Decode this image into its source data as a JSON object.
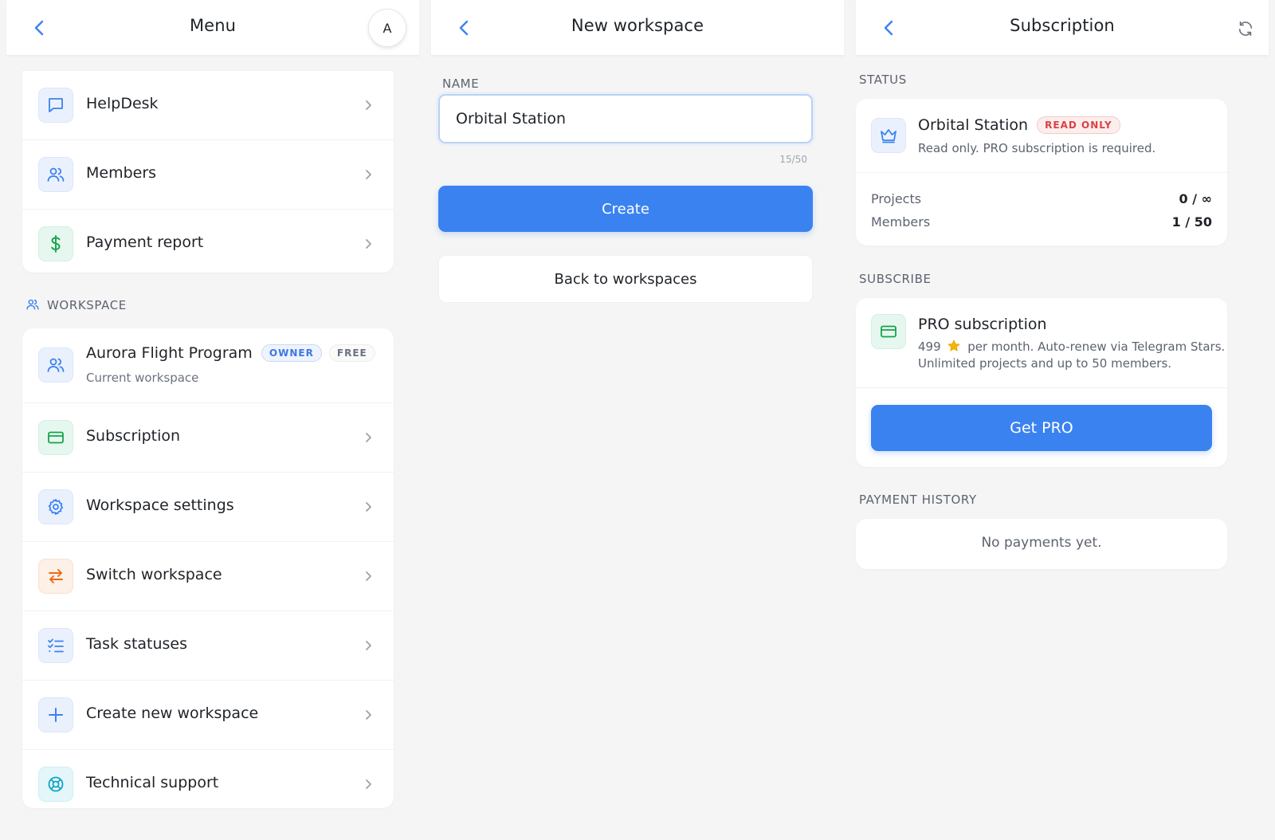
{
  "menu": {
    "title": "Menu",
    "avatar_letter": "A",
    "top_items": [
      {
        "label": "HelpDesk",
        "icon": "chat-bubble-icon"
      },
      {
        "label": "Members",
        "icon": "users-icon"
      },
      {
        "label": "Payment report",
        "icon": "dollar-icon"
      }
    ],
    "workspace_section_label": "WORKSPACE",
    "current_workspace": {
      "name": "Aurora Flight Program",
      "owner_badge": "OWNER",
      "plan_badge": "FREE",
      "subtitle": "Current workspace"
    },
    "workspace_items": [
      {
        "label": "Subscription",
        "icon": "credit-card-icon"
      },
      {
        "label": "Workspace settings",
        "icon": "gear-icon"
      },
      {
        "label": "Switch workspace",
        "icon": "swap-arrows-icon"
      },
      {
        "label": "Task statuses",
        "icon": "checklist-icon"
      },
      {
        "label": "Create new workspace",
        "icon": "plus-icon"
      },
      {
        "label": "Technical support",
        "icon": "lifebuoy-icon"
      }
    ]
  },
  "new_workspace": {
    "title": "New workspace",
    "name_label": "NAME",
    "name_value": "Orbital Station",
    "char_counter": "15/50",
    "create_label": "Create",
    "back_label": "Back to workspaces"
  },
  "subscription": {
    "title": "Subscription",
    "status_label": "STATUS",
    "status": {
      "workspace_name": "Orbital Station",
      "badge": "READ ONLY",
      "description": "Read only. PRO subscription is required.",
      "projects_label": "Projects",
      "projects_value": "0 / ∞",
      "members_label": "Members",
      "members_value": "1 / 50"
    },
    "subscribe_label": "SUBSCRIBE",
    "plan": {
      "name": "PRO subscription",
      "price": "499",
      "price_suffix": "per month. Auto-renew via Telegram Stars.",
      "details": "Unlimited projects and up to 50 members.",
      "button_label": "Get PRO"
    },
    "payment_history_label": "PAYMENT HISTORY",
    "payment_history_empty": "No payments yet."
  },
  "colors": {
    "accent": "#3b82f1",
    "background": "#f5f5f5",
    "read_only": "#d94343",
    "owner": "#3b78e7",
    "green": "#16a34a",
    "star": "#f4b400"
  }
}
